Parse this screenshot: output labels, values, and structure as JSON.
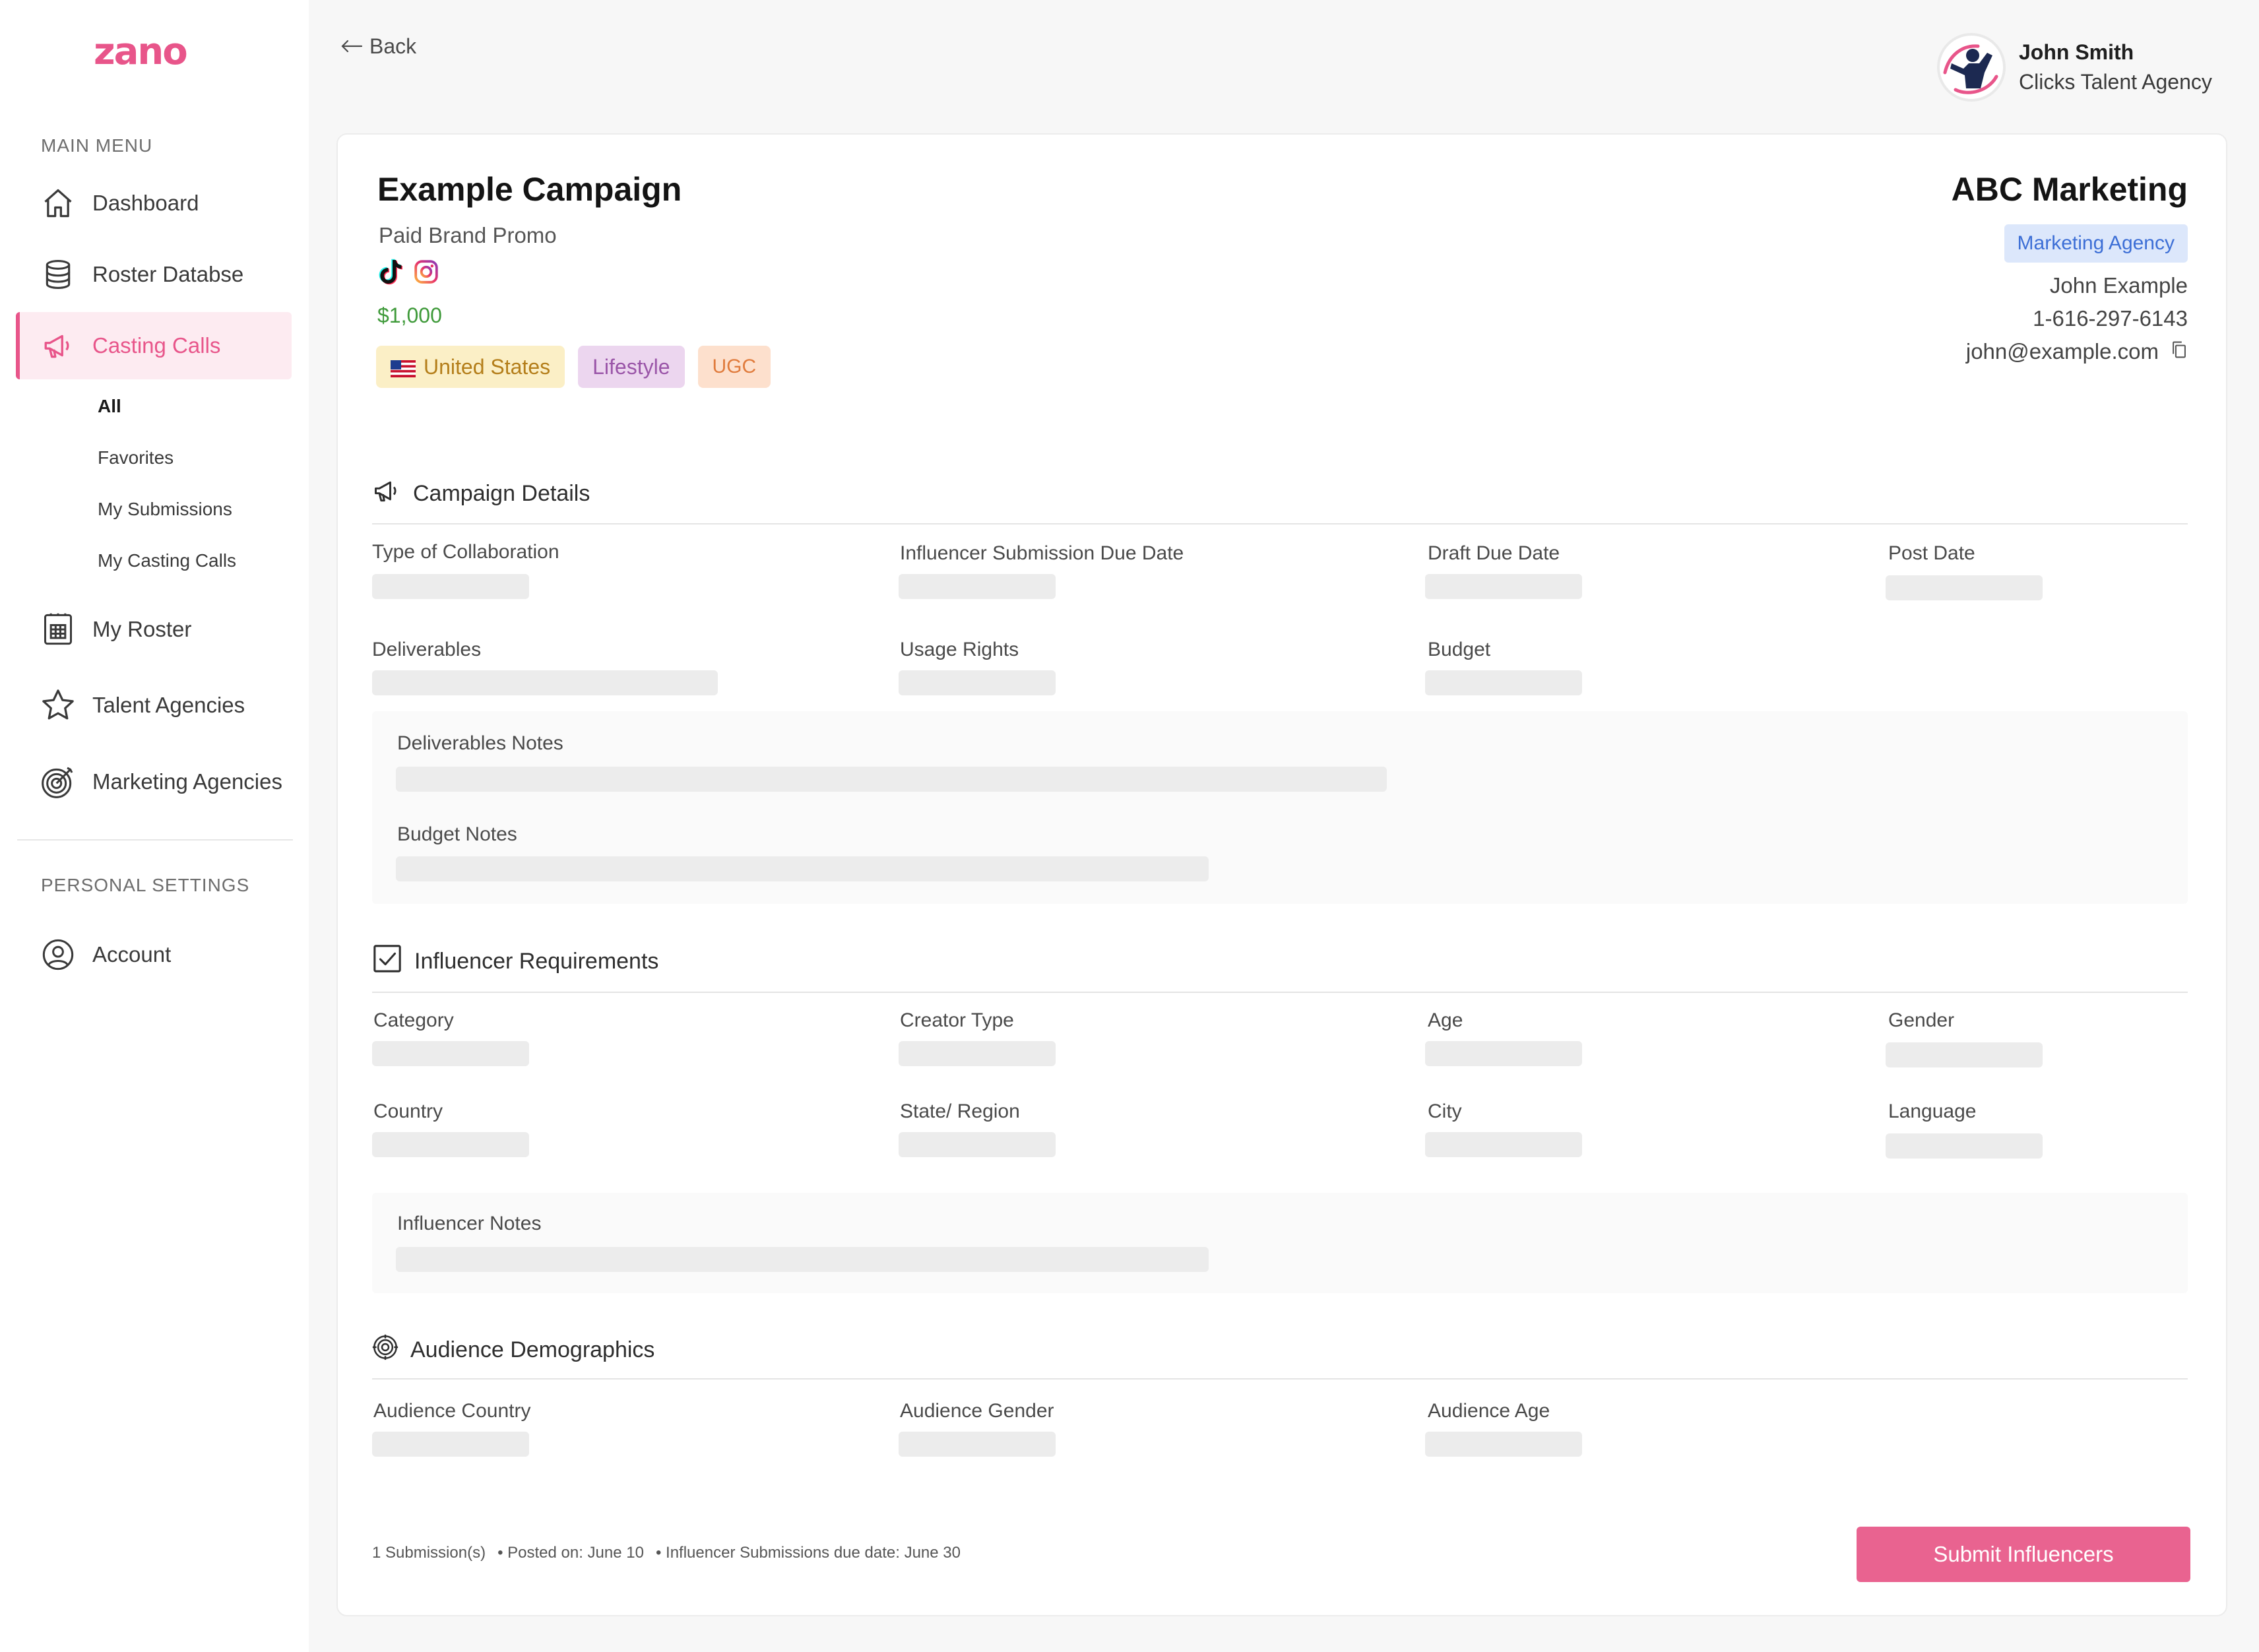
{
  "app": {
    "logo_text": "zano"
  },
  "sidebar": {
    "main_menu_heading": "MAIN MENU",
    "items": [
      {
        "label": "Dashboard"
      },
      {
        "label": "Roster Databse"
      },
      {
        "label": "Casting Calls"
      },
      {
        "label": "My Roster"
      },
      {
        "label": "Talent Agencies"
      },
      {
        "label": "Marketing Agencies"
      }
    ],
    "casting_subitems": [
      {
        "label": "All"
      },
      {
        "label": "Favorites"
      },
      {
        "label": "My Submissions"
      },
      {
        "label": "My Casting Calls"
      }
    ],
    "personal_heading": "PERSONAL SETTINGS",
    "account_label": "Account"
  },
  "header": {
    "back_label": "Back",
    "user_name": "John Smith",
    "user_agency": "Clicks Talent Agency"
  },
  "campaign": {
    "title": "Example Campaign",
    "type": "Paid Brand Promo",
    "price": "$1,000",
    "tags": {
      "country": "United States",
      "category": "Lifestyle",
      "format": "UGC"
    }
  },
  "company": {
    "name": "ABC Marketing",
    "badge": "Marketing Agency",
    "contact_name": "John Example",
    "phone": "1-616-297-6143",
    "email": "john@example.com"
  },
  "campaign_details": {
    "heading": "Campaign Details",
    "labels": {
      "collaboration": "Type of Collaboration",
      "submission_due": "Influencer Submission Due Date",
      "draft_due": "Draft Due Date",
      "post_date": "Post Date",
      "deliverables": "Deliverables",
      "usage_rights": "Usage Rights",
      "budget": "Budget",
      "deliverables_notes": "Deliverables Notes",
      "budget_notes": "Budget Notes"
    }
  },
  "influencer_requirements": {
    "heading": "Influencer Requirements",
    "labels": {
      "category": "Category",
      "creator_type": "Creator Type",
      "age": "Age",
      "gender": "Gender",
      "country": "Country",
      "state_region": "State/ Region",
      "city": "City",
      "language": "Language",
      "influencer_notes": "Influencer Notes"
    }
  },
  "audience": {
    "heading": "Audience Demographics",
    "labels": {
      "country": "Audience Country",
      "gender": "Audience Gender",
      "age": "Audience Age"
    }
  },
  "footer": {
    "submissions": "1 Submission(s)",
    "posted_on": "• Posted on: June 10",
    "due_date": "•  Influencer Submissions due date: June 30",
    "submit_label": "Submit Influencers"
  },
  "colors": {
    "brand_pink": "#e8558a",
    "submit_button": "#e96390",
    "price_green": "#3f9a3a",
    "badge_blue": "#3d6fd6"
  },
  "icons": {
    "dashboard": "home-icon",
    "roster_database": "database-icon",
    "casting_calls": "megaphone-icon",
    "my_roster": "roster-icon",
    "talent_agencies": "star-icon",
    "marketing_agencies": "target-icon",
    "account": "user-circle-icon"
  }
}
